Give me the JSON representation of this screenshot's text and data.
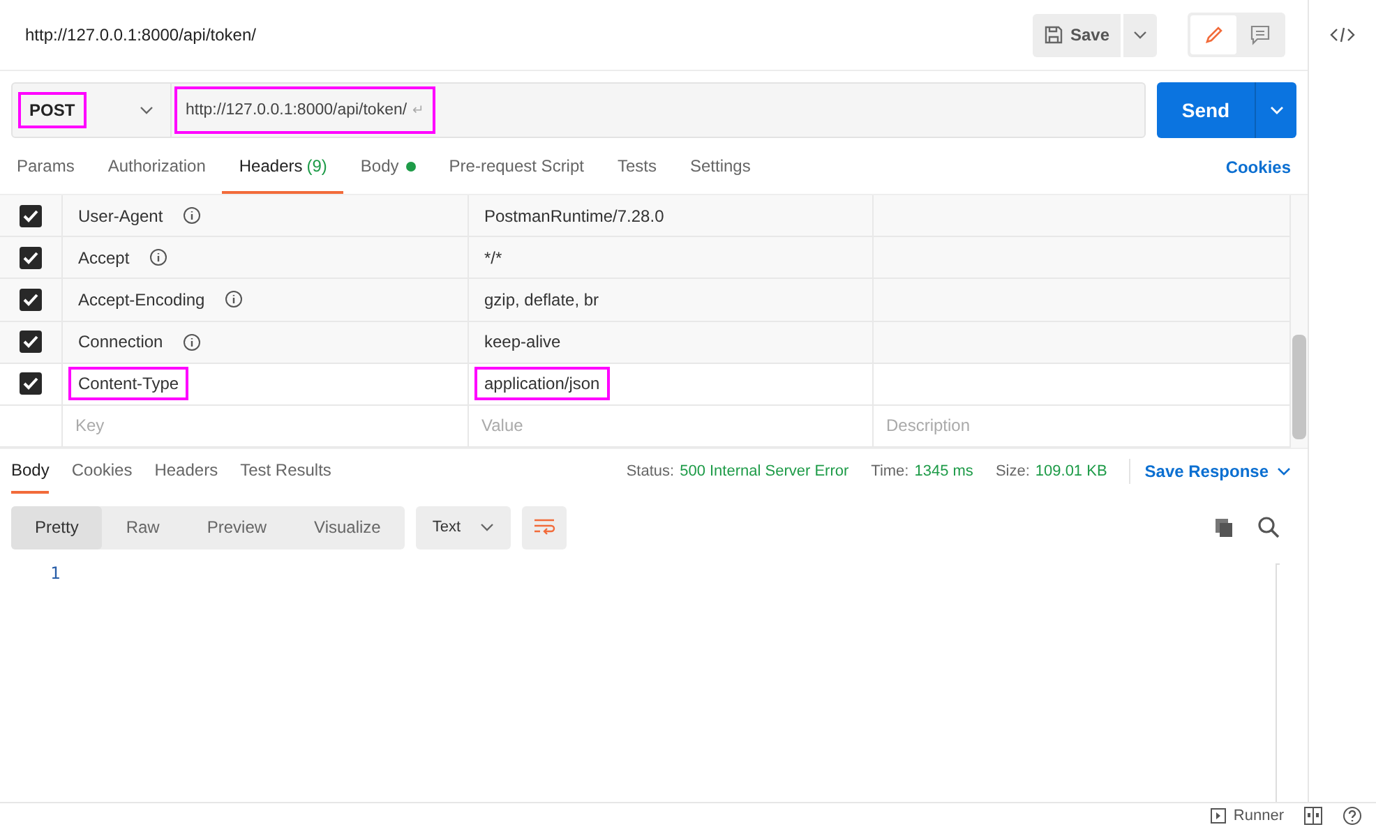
{
  "request": {
    "title": "http://127.0.0.1:8000/api/token/",
    "save_label": "Save",
    "method": {
      "label": "POST",
      "highlighted": true
    },
    "url": {
      "value": "http://127.0.0.1:8000/api/token/",
      "line_break_mark": "↵",
      "highlighted": true
    },
    "send_label": "Send",
    "mode_toggle": [
      {
        "kind": "edit",
        "selected": true
      },
      {
        "kind": "comments",
        "selected": false
      }
    ]
  },
  "request_tabs": [
    {
      "label": "Params",
      "dot": false,
      "selected": false
    },
    {
      "label": "Authorization",
      "dot": false,
      "selected": false
    },
    {
      "label": "Headers",
      "count": "(9)",
      "dot": false,
      "selected": true
    },
    {
      "label": "Body",
      "dot": true,
      "selected": false
    },
    {
      "label": "Pre-request Script",
      "dot": false,
      "selected": false
    },
    {
      "label": "Tests",
      "dot": false,
      "selected": false
    },
    {
      "label": "Settings",
      "dot": false,
      "selected": false
    }
  ],
  "cookies_link": "Cookies",
  "headers": {
    "rows": [
      {
        "key": "User-Agent",
        "info": true,
        "value": "PostmanRuntime/7.28.0",
        "checked": true,
        "key_highlighted": false,
        "value_highlighted": false
      },
      {
        "key": "Accept",
        "info": true,
        "value": "*/*",
        "checked": true,
        "key_highlighted": false,
        "value_highlighted": false
      },
      {
        "key": "Accept-Encoding",
        "info": true,
        "value": "gzip, deflate, br",
        "checked": true,
        "key_highlighted": false,
        "value_highlighted": false
      },
      {
        "key": "Connection",
        "info": true,
        "value": "keep-alive",
        "checked": true,
        "key_highlighted": false,
        "value_highlighted": false
      },
      {
        "key": "Content-Type",
        "info": false,
        "value": "application/json",
        "checked": true,
        "key_highlighted": true,
        "value_highlighted": true
      }
    ],
    "new_row": {
      "key_placeholder": "Key",
      "value_placeholder": "Value",
      "description_placeholder": "Description"
    }
  },
  "response_tabs": [
    {
      "label": "Body",
      "selected": true
    },
    {
      "label": "Cookies",
      "selected": false
    },
    {
      "label": "Headers",
      "selected": false
    },
    {
      "label": "Test Results",
      "selected": false
    }
  ],
  "status": [
    {
      "label": "Status:",
      "value": "500 Internal Server Error"
    },
    {
      "label": "Time:",
      "value": "1345 ms"
    },
    {
      "label": "Size:",
      "value": "109.01 KB"
    }
  ],
  "save_response": "Save Response",
  "view_modes": [
    {
      "label": "Pretty",
      "selected": true
    },
    {
      "label": "Raw",
      "selected": false
    },
    {
      "label": "Preview",
      "selected": false
    },
    {
      "label": "Visualize",
      "selected": false
    }
  ],
  "format": "Text",
  "line_numbers": [
    "1"
  ],
  "footer": {
    "runner": "Runner"
  }
}
